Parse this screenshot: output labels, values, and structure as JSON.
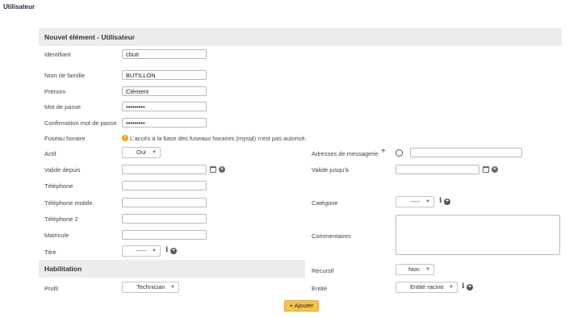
{
  "page_title": "Utilisateur",
  "form": {
    "title": "Nouvel élément - Utilisateur",
    "identifiant": {
      "label": "Identifiant",
      "value": "cbuti"
    },
    "nom": {
      "label": "Nom de famille",
      "value": "BUTILLON"
    },
    "prenom": {
      "label": "Prénom",
      "value": "Clément"
    },
    "password": {
      "label": "Mot de passe",
      "value": "•••••••••"
    },
    "password_confirm": {
      "label": "Confirmation mot de passe",
      "value": "•••••••••"
    },
    "fuseau": {
      "label": "Fuseau horaire",
      "warning": "L'accès à la base des fuseaux horaires (mysql) n'est pas autorisé."
    },
    "actif": {
      "label": "Actif",
      "value": "Oui"
    },
    "messagerie": {
      "label": "Adresses de messagerie",
      "value": ""
    },
    "valide_depuis": {
      "label": "Valide depuis",
      "value": ""
    },
    "valide_jusqua": {
      "label": "Valide jusqu'à",
      "value": ""
    },
    "telephone": {
      "label": "Téléphone",
      "value": ""
    },
    "telephone_mobile": {
      "label": "Téléphone mobile",
      "value": ""
    },
    "categorie": {
      "label": "Catégorie",
      "value": "-----"
    },
    "telephone2": {
      "label": "Téléphone 2",
      "value": ""
    },
    "matricule": {
      "label": "Matricule",
      "value": ""
    },
    "commentaires": {
      "label": "Commentaires",
      "value": ""
    },
    "titre": {
      "label": "Titre",
      "value": "-----"
    }
  },
  "habilitation": {
    "title": "Habilitation",
    "recursif": {
      "label": "Récursif",
      "value": "Non"
    },
    "profil": {
      "label": "Profil",
      "value": "Technician"
    },
    "entite": {
      "label": "Entité",
      "value": "Entité racine"
    }
  },
  "add_button": "+ Ajouter",
  "colors": {
    "accent_button": "#f6c44c",
    "header_bg": "#ececec",
    "warning": "#f0a500"
  },
  "icons": [
    "calendar-icon",
    "clear-icon",
    "info-icon",
    "add-circle-icon",
    "warning-icon",
    "plus-icon"
  ]
}
